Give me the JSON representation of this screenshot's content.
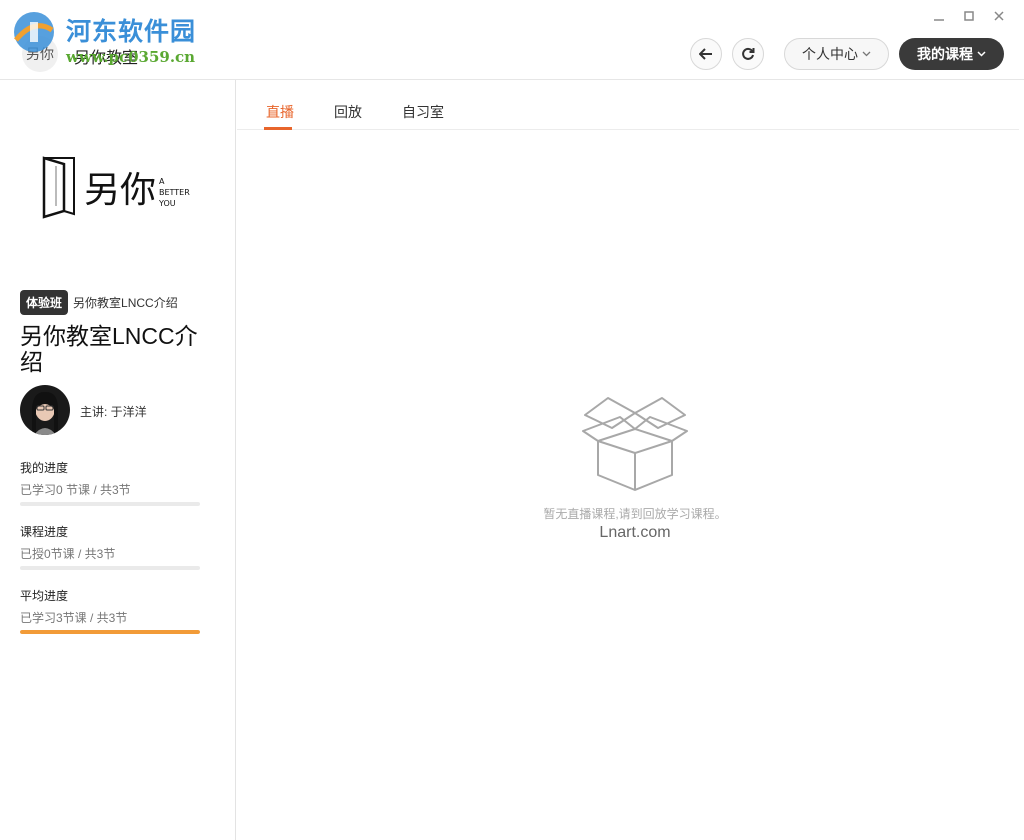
{
  "window": {
    "title": "另你教室",
    "logo_text": "另你",
    "watermark_title": "河东软件园",
    "watermark_url": "www.pc0359.cn"
  },
  "toolbar": {
    "back_icon": "arrow-left-icon",
    "refresh_icon": "refresh-icon",
    "personal_center_label": "个人中心",
    "my_courses_label": "我的课程"
  },
  "sidebar": {
    "brand": {
      "main": "另你",
      "sub_line1": "A",
      "sub_line2": "BETTER",
      "sub_line3": "YOU"
    },
    "tag": "体验班",
    "tag_text": "另你教室LNCC介绍",
    "course_title": "另你教室LNCC介绍",
    "lecturer": "主讲: 于洋洋",
    "progress": [
      {
        "label": "我的进度",
        "sub": "已学习0 节课 / 共3节",
        "value": 0
      },
      {
        "label": "课程进度",
        "sub": "已授0节课 / 共3节",
        "value": 0
      },
      {
        "label": "平均进度",
        "sub": "已学习3节课 / 共3节",
        "value": 1
      }
    ]
  },
  "main": {
    "tabs": [
      {
        "label": "直播",
        "active": true
      },
      {
        "label": "回放",
        "active": false
      },
      {
        "label": "自习室",
        "active": false
      }
    ],
    "empty_text": "暂无直播课程,请到回放学习课程。",
    "empty_link": "Lnart.com"
  },
  "colors": {
    "accent": "#e8652b",
    "progress": "#f29b38",
    "dark_button": "#3a3a3a"
  }
}
